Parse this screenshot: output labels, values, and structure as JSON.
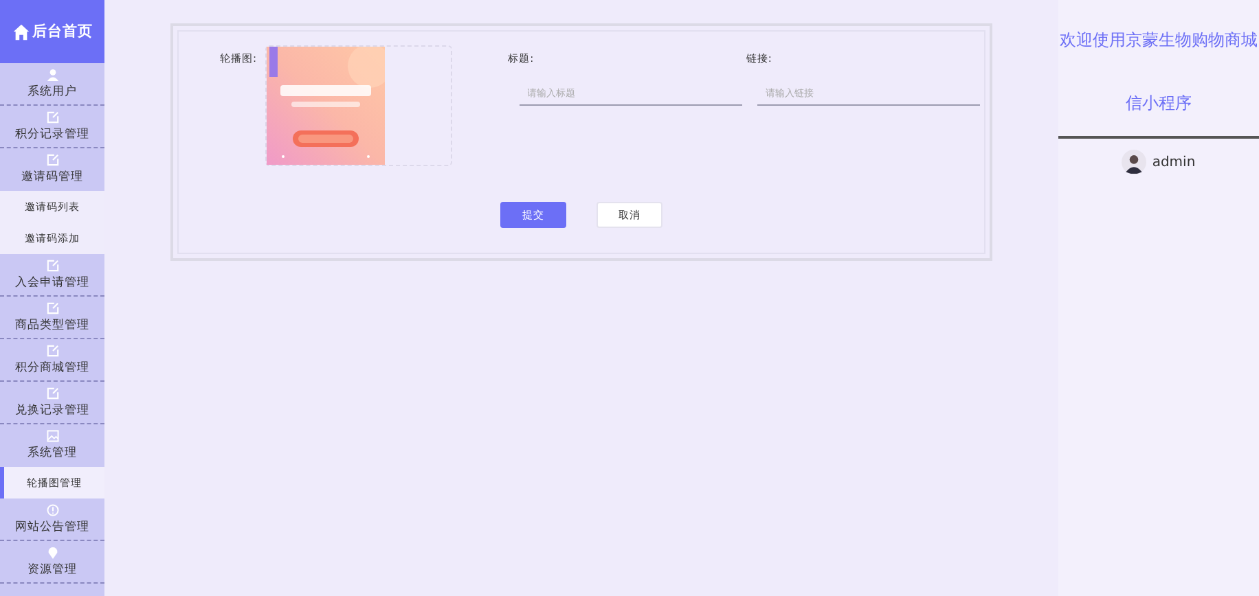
{
  "sidebar": {
    "header": {
      "title": "后台首页"
    },
    "items": [
      {
        "label": "系统用户",
        "expanded": false
      },
      {
        "label": "积分记录管理",
        "expanded": false
      },
      {
        "label": "邀请码管理",
        "expanded": true,
        "children": [
          {
            "label": "邀请码列表",
            "selected": false
          },
          {
            "label": "邀请码添加",
            "selected": false
          }
        ]
      },
      {
        "label": "入会申请管理",
        "expanded": false
      },
      {
        "label": "商品类型管理",
        "expanded": false
      },
      {
        "label": "积分商城管理",
        "expanded": false
      },
      {
        "label": "兑换记录管理",
        "expanded": false
      },
      {
        "label": "系统管理",
        "expanded": true,
        "children": [
          {
            "label": "轮播图管理",
            "selected": true
          }
        ]
      },
      {
        "label": "网站公告管理",
        "expanded": false
      },
      {
        "label": "资源管理",
        "expanded": false
      }
    ]
  },
  "form": {
    "image_field": {
      "label": "轮播图:",
      "kind": "picture"
    },
    "fields": [
      {
        "label": "标题:",
        "placeholder": "请输入标题"
      },
      {
        "label": "链接:",
        "placeholder": "请输入链接"
      }
    ],
    "buttons": [
      {
        "label": "提交",
        "kind": "primary"
      },
      {
        "label": "取消",
        "kind": "default"
      }
    ]
  },
  "welcome": {
    "title_lines": [
      "欢迎使用京蒙生物购物商城",
      "信小程序"
    ],
    "user": "admin"
  }
}
